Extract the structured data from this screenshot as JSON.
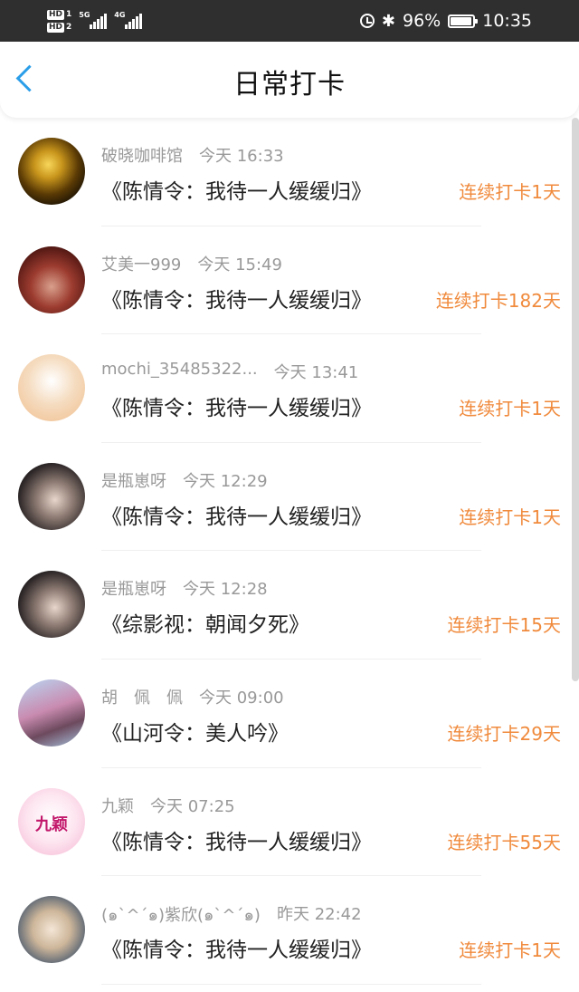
{
  "status_bar": {
    "hd1": "HD",
    "sim1": "1",
    "hd2": "HD",
    "sim2": "2",
    "net1": "5G",
    "net2": "4G",
    "battery": "96%",
    "battery_level": 0.96,
    "time": "10:35",
    "icons": [
      "alarm-icon",
      "bluetooth-icon",
      "battery-icon"
    ]
  },
  "header": {
    "title": "日常打卡",
    "back_icon": "chevron-left-icon",
    "accent_color": "#2b9ee9"
  },
  "colors": {
    "streak": "#f08a3c",
    "meta": "#999999"
  },
  "checkins": [
    {
      "user": "破晓咖啡馆",
      "time": "今天 16:33",
      "book": "《陈情令：我待一人缓缓归》",
      "streak": "连续打卡1天",
      "avatar": "gold-coins-avatar"
    },
    {
      "user": "艾美一999",
      "time": "今天 15:49",
      "book": "《陈情令：我待一人缓缓归》",
      "streak": "连续打卡182天",
      "avatar": "red-poster-avatar"
    },
    {
      "user": "mochi_35485322...",
      "time": "今天 13:41",
      "book": "《陈情令：我待一人缓缓归》",
      "streak": "连续打卡1天",
      "avatar": "chibi-character-avatar"
    },
    {
      "user": "是瓶崽呀",
      "time": "今天 12:29",
      "book": "《陈情令：我待一人缓缓归》",
      "streak": "连续打卡1天",
      "avatar": "anime-man-avatar"
    },
    {
      "user": "是瓶崽呀",
      "time": "今天 12:28",
      "book": "《综影视：朝闻夕死》",
      "streak": "连续打卡15天",
      "avatar": "anime-man-avatar"
    },
    {
      "user": "胡　佩　佩",
      "time": "今天 09:00",
      "book": "《山河令：美人吟》",
      "streak": "连续打卡29天",
      "avatar": "blossom-tree-avatar"
    },
    {
      "user": "九颖",
      "time": "今天 07:25",
      "book": "《陈情令：我待一人缓缓归》",
      "streak": "连续打卡55天",
      "avatar": "pink-girl-avatar",
      "avatar_text": "九颖"
    },
    {
      "user": "(๑`^´๑)紫欣(๑`^´๑)",
      "time": "昨天 22:42",
      "book": "《陈情令：我待一人缓缓归》",
      "streak": "连续打卡1天",
      "avatar": "hooded-character-avatar"
    }
  ]
}
